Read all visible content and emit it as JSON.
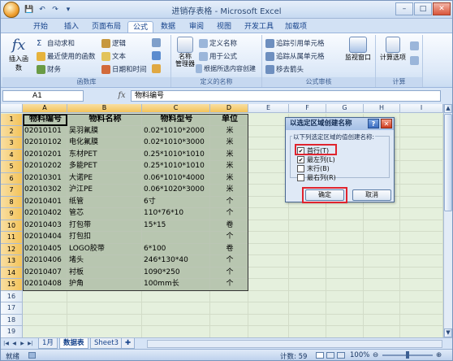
{
  "window": {
    "title": "进销存表格 - Microsoft Excel",
    "minimize": "–",
    "maximize": "□",
    "close": "✕"
  },
  "qat": [
    "💾",
    "↶",
    "↷",
    "▾"
  ],
  "tabs": [
    "开始",
    "插入",
    "页面布局",
    "公式",
    "数据",
    "审阅",
    "视图",
    "开发工具",
    "加载项"
  ],
  "active_tab": "公式",
  "ribbon": {
    "insert_function": "插入函数",
    "g1": {
      "autosum": "自动求和",
      "recent": "最近使用的函数",
      "financial": "财务",
      "logical": "逻辑",
      "text": "文本",
      "datetime": "日期和时间",
      "label": "函数库"
    },
    "g2": {
      "name_manager": "名称\n管理器",
      "define_name": "定义名称",
      "use_in_formula": "用于公式",
      "create_from_sel": "根据所选内容创建",
      "label": "定义的名称"
    },
    "g3": {
      "trace_prec": "追踪引用单元格",
      "trace_dep": "追踪从属单元格",
      "remove_arrows": "移去箭头",
      "watch": "监视窗口",
      "label": "公式审核"
    },
    "g4": {
      "calc_options": "计算选项",
      "label": "计算"
    }
  },
  "formula_bar": {
    "name_box": "A1",
    "fx": "fx",
    "formula": "物料编号"
  },
  "columns": [
    "A",
    "B",
    "C",
    "D",
    "E",
    "F",
    "G",
    "H",
    "I"
  ],
  "rows": [
    "1",
    "2",
    "3",
    "4",
    "5",
    "6",
    "7",
    "8",
    "9",
    "10",
    "11",
    "12",
    "13",
    "14",
    "15",
    "16",
    "17",
    "18",
    "19"
  ],
  "table": {
    "headers": [
      "物料编号",
      "物料名称",
      "物料型号",
      "单位"
    ],
    "data": [
      [
        "02010101",
        "吴羽氟膜",
        "0.02*1010*2000",
        "米"
      ],
      [
        "02010102",
        "电化氟膜",
        "0.02*1010*3000",
        "米"
      ],
      [
        "02010201",
        "东材PET",
        "0.25*1010*1010",
        "米"
      ],
      [
        "02010202",
        "多能PET",
        "0.25*1010*1010",
        "米"
      ],
      [
        "02010301",
        "大诺PE",
        "0.06*1010*4000",
        "米"
      ],
      [
        "02010302",
        "沪江PE",
        "0.06*1020*3000",
        "米"
      ],
      [
        "02010401",
        "纸管",
        "6寸",
        "个"
      ],
      [
        "02010402",
        "管芯",
        "110*76*10",
        "个"
      ],
      [
        "02010403",
        "打包带",
        "15*15",
        "卷"
      ],
      [
        "02010404",
        "打包扣",
        "",
        "个"
      ],
      [
        "02010405",
        "LOGO胶带",
        "6*100",
        "卷"
      ],
      [
        "02010406",
        "堵头",
        "246*130*40",
        "个"
      ],
      [
        "02010407",
        "衬板",
        "1090*250",
        "个"
      ],
      [
        "02010408",
        "护角",
        "100mm长",
        "个"
      ]
    ]
  },
  "dialog": {
    "title": "以选定区域创建名称",
    "help": "?",
    "close": "✕",
    "group_label": "以下列选定区域的值创建名称:",
    "options": [
      {
        "label": "首行(T)",
        "checked": true
      },
      {
        "label": "最左列(L)",
        "checked": true
      },
      {
        "label": "末行(B)",
        "checked": false
      },
      {
        "label": "最右列(R)",
        "checked": false
      }
    ],
    "ok": "确定",
    "cancel": "取消"
  },
  "sheets": [
    "1月",
    "数据表",
    "Sheet3"
  ],
  "active_sheet": "数据表",
  "status": {
    "ready": "就绪",
    "count": "计数: 59",
    "zoom": "100%"
  }
}
